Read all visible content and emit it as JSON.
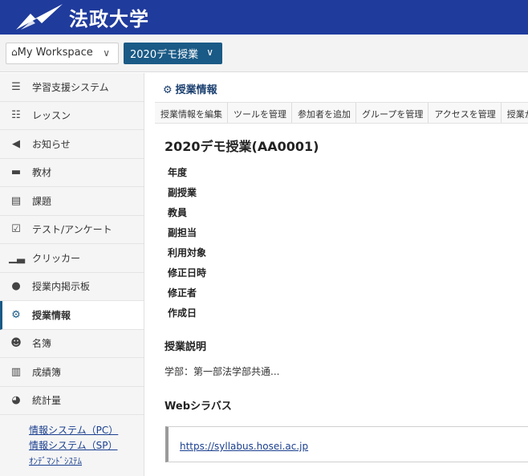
{
  "header": {
    "logo_text": "法政大学",
    "logo_icon": "hosei-logo-icon"
  },
  "sitebar": {
    "workspace_label": "My Workspace",
    "site_label": "2020デモ授業"
  },
  "sidebar": {
    "items": [
      {
        "label": "学習支援システム",
        "icon": "list-icon"
      },
      {
        "label": "レッスン",
        "icon": "book-icon"
      },
      {
        "label": "お知らせ",
        "icon": "megaphone-icon"
      },
      {
        "label": "教材",
        "icon": "folder-icon"
      },
      {
        "label": "課題",
        "icon": "file-icon"
      },
      {
        "label": "テスト/アンケート",
        "icon": "checkbox-icon"
      },
      {
        "label": "クリッカー",
        "icon": "bar-chart-icon"
      },
      {
        "label": "授業内掲示板",
        "icon": "comments-icon"
      },
      {
        "label": "授業情報",
        "icon": "gear-icon"
      },
      {
        "label": "名簿",
        "icon": "users-icon"
      },
      {
        "label": "成績簿",
        "icon": "gradebook-icon"
      },
      {
        "label": "統計量",
        "icon": "pie-chart-icon"
      }
    ],
    "active_index": 8,
    "sub_links": [
      "情報システム（PC）",
      "情報システム（SP）",
      "ｵﾝﾃﾞﾏﾝﾄﾞｼｽﾃﾑ"
    ]
  },
  "main": {
    "tool_title": "授業情報",
    "toolbar": [
      "授業情報を編集",
      "ツールを管理",
      "参加者を追加",
      "グループを管理",
      "アクセスを管理",
      "授業か"
    ],
    "site_title": "2020デモ授業(AA0001)",
    "fields": [
      "年度",
      "副授業",
      "教員",
      "副担当",
      "利用対象",
      "修正日時",
      "修正者",
      "作成日"
    ],
    "description_heading": "授業説明",
    "description_text": "学部：第一部法学部共通...",
    "syllabus_heading": "Webシラバス",
    "syllabus_url": "https://syllabus.hosei.ac.jp"
  }
}
